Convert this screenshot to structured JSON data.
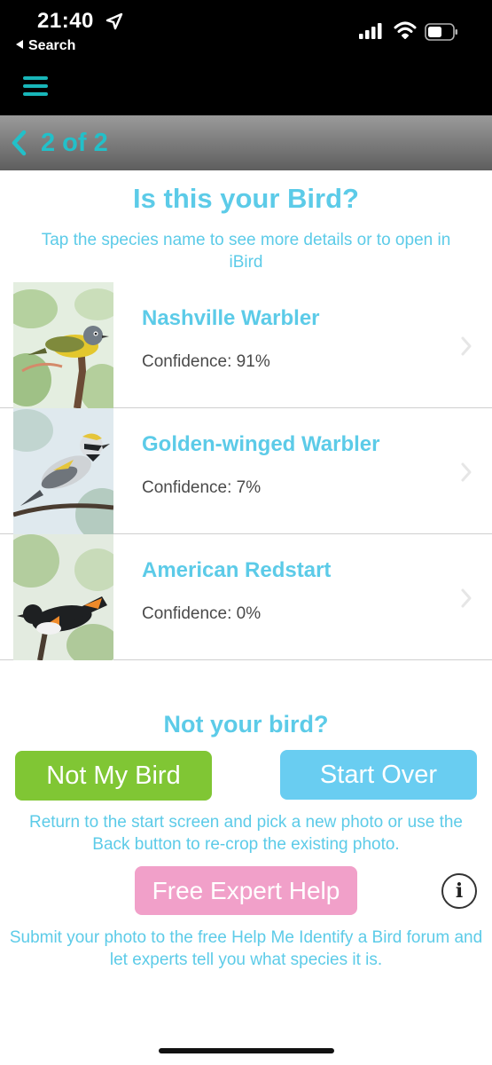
{
  "status_bar": {
    "time": "21:40",
    "back_label": "Search"
  },
  "nav": {
    "pager": "2 of 2"
  },
  "header": {
    "title": "Is this your Bird?",
    "subtitle": "Tap the species name to see more details or to open in iBird"
  },
  "results": [
    {
      "name": "Nashville Warbler",
      "confidence": "Confidence: 91%"
    },
    {
      "name": "Golden-winged Warbler",
      "confidence": "Confidence: 7%"
    },
    {
      "name": "American Redstart",
      "confidence": "Confidence: 0%"
    }
  ],
  "footer": {
    "question": "Not your bird?",
    "not_my_bird_label": "Not My Bird",
    "start_over_label": "Start Over",
    "return_text": "Return to the start screen and pick a new photo or use the Back button to re-crop the existing photo.",
    "expert_help_label": "Free Expert Help",
    "info_label": "i",
    "expert_text": "Submit your photo to the free Help Me Identify a Bird forum and let experts tell you what species it is."
  },
  "colors": {
    "accent_teal": "#22c0c9",
    "text_blue": "#5ccbe8",
    "green_button": "#80c634",
    "blue_button": "#69cdf1",
    "pink_button": "#f1a0c9"
  },
  "icons": [
    "location-arrow-icon",
    "signal-icon",
    "wifi-icon",
    "battery-icon",
    "hamburger-menu-icon",
    "chevron-left-icon",
    "chevron-right-icon",
    "info-icon"
  ]
}
